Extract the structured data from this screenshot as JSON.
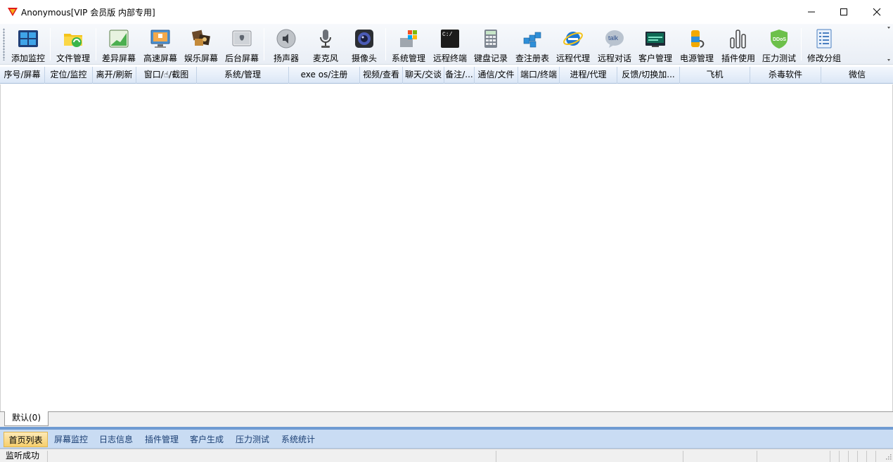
{
  "window": {
    "title": "Anonymous[VIP 会员版 内部专用]"
  },
  "toolbar": {
    "buttons": [
      {
        "label": "添加监控"
      },
      {
        "label": "文件管理"
      },
      {
        "label": "差异屏幕"
      },
      {
        "label": "高速屏幕"
      },
      {
        "label": "娱乐屏幕"
      },
      {
        "label": "后台屏幕"
      },
      {
        "label": "扬声器"
      },
      {
        "label": "麦克风"
      },
      {
        "label": "摄像头"
      },
      {
        "label": "系统管理"
      },
      {
        "label": "远程终端"
      },
      {
        "label": "键盘记录"
      },
      {
        "label": "查注册表"
      },
      {
        "label": "远程代理"
      },
      {
        "label": "远程对话"
      },
      {
        "label": "客户管理"
      },
      {
        "label": "电源管理"
      },
      {
        "label": "插件使用"
      },
      {
        "label": "压力测试"
      },
      {
        "label": "修改分组"
      }
    ],
    "icon_texts": {
      "terminal": "C:/",
      "talk": "talk",
      "ddos": "DDoS"
    }
  },
  "columns": [
    "序号/屏幕",
    "定位/监控",
    "离开/刷新",
    "窗口/☝/截图",
    "系统/管理",
    "exe os/注册",
    "视频/查看",
    "聊天/交谈",
    "备注/...",
    "通信/文件",
    "端口/终端",
    "进程/代理",
    "反馈/切换加...",
    "飞机",
    "杀毒软件",
    "微信"
  ],
  "group_tab": {
    "label": "默认(0)"
  },
  "bottom_tabs": [
    {
      "label": "首页列表",
      "active": true
    },
    {
      "label": "屏幕监控"
    },
    {
      "label": "日志信息"
    },
    {
      "label": "插件管理"
    },
    {
      "label": "客户生成"
    },
    {
      "label": "压力测试"
    },
    {
      "label": "系统统计"
    }
  ],
  "status": {
    "text": "监听成功"
  },
  "colors": {
    "accent_blue": "#6f9bd2",
    "active_tab": "#f7cf6c",
    "header_blue": "#dbe7f6"
  }
}
